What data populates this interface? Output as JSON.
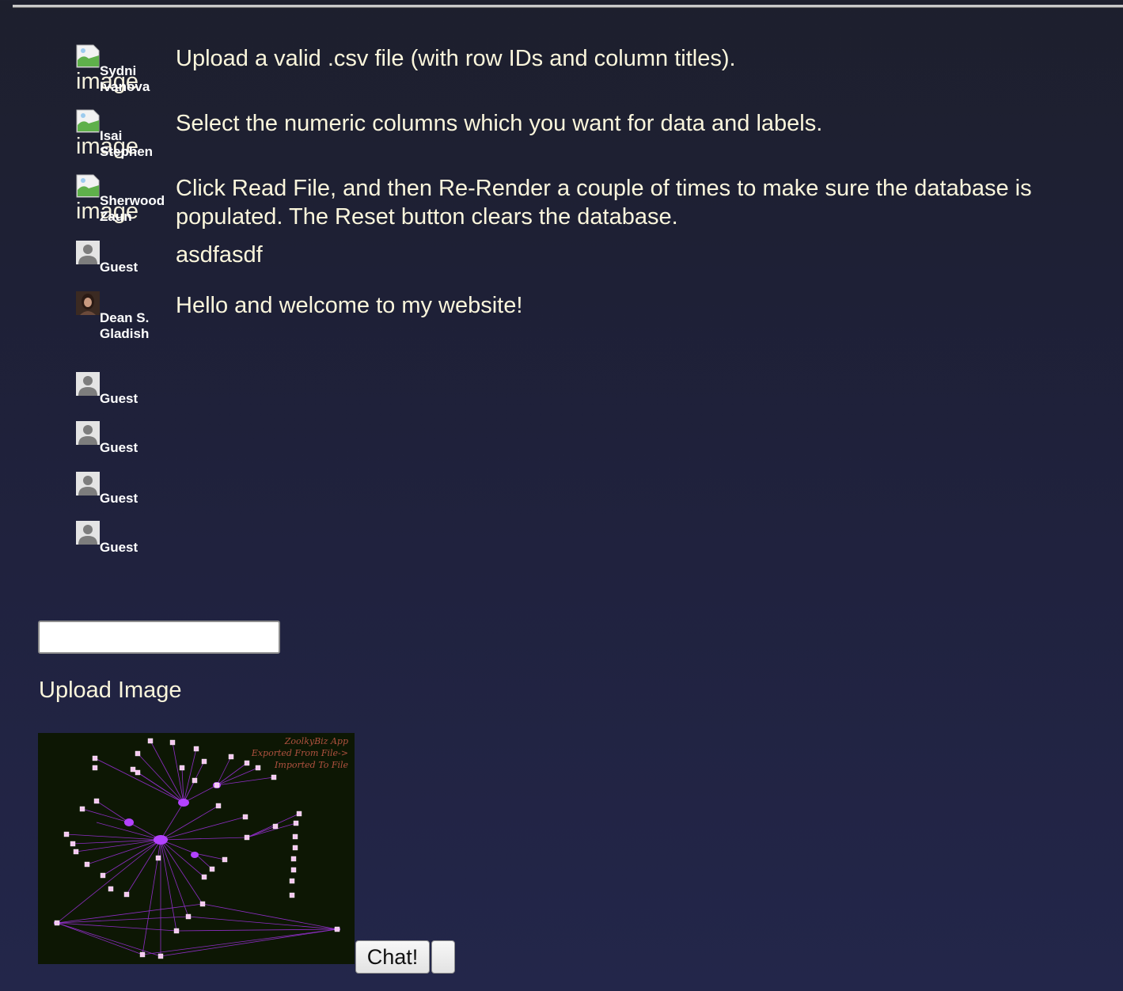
{
  "messages": [
    {
      "user": "Sydni Ivanova",
      "avatar_type": "broken-image",
      "avatar_alt": "image",
      "text": "Upload a valid .csv file (with row IDs and column titles)."
    },
    {
      "user": "Isai Stephen",
      "avatar_type": "broken-image",
      "avatar_alt": "image",
      "text": "Select the numeric columns which you want for data and labels."
    },
    {
      "user": "Sherwood Zaun",
      "avatar_type": "broken-image",
      "avatar_alt": "image",
      "text": "Click Read File, and then Re-Render a couple of times to make sure the database is populated. The Reset button clears the database."
    },
    {
      "user": "Guest",
      "avatar_type": "guest-silhouette",
      "text": "asdfasdf"
    },
    {
      "user": "Dean S. Gladish",
      "avatar_type": "photo",
      "text": "Hello and welcome to my website!"
    },
    {
      "user": "Guest",
      "avatar_type": "guest-silhouette",
      "text": ""
    },
    {
      "user": "Guest",
      "avatar_type": "guest-silhouette",
      "text": ""
    },
    {
      "user": "Guest",
      "avatar_type": "guest-silhouette",
      "text": ""
    },
    {
      "user": "Guest",
      "avatar_type": "guest-silhouette",
      "text": ""
    }
  ],
  "composer": {
    "input_value": "",
    "upload_label": "Upload Image",
    "preview_watermark": [
      "ZoolkyBiz App",
      "Exported From File->",
      "Imported To File"
    ],
    "preview_image": "network-graph-diagram",
    "chat_button_label": "Chat!",
    "extra_button_label": ""
  },
  "colors": {
    "text": "#fbf6dc",
    "preview_background": "#0d1704",
    "graph_edges": "#9b30d9",
    "graph_nodes": "#f5c8f0",
    "watermark": "#b0523f"
  }
}
